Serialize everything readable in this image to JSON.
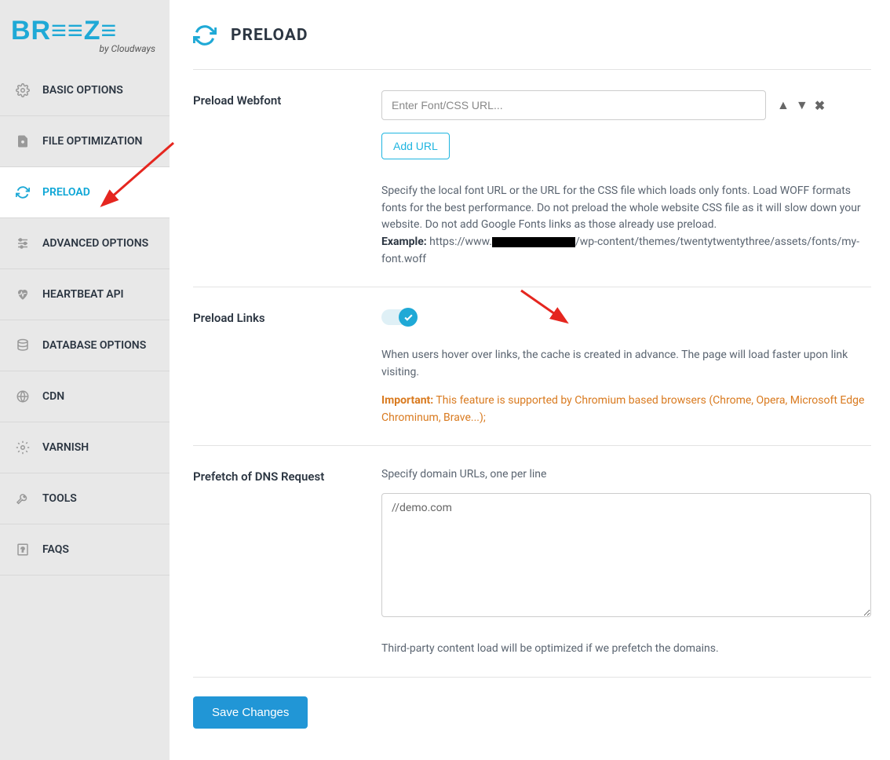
{
  "logo": {
    "brand": "BR≡≡Z≡",
    "by": "by Cloudways"
  },
  "sidebar": {
    "items": [
      {
        "label": "BASIC OPTIONS",
        "icon": "gear-icon"
      },
      {
        "label": "FILE OPTIMIZATION",
        "icon": "file-gear-icon"
      },
      {
        "label": "PRELOAD",
        "icon": "refresh-icon",
        "active": true
      },
      {
        "label": "ADVANCED OPTIONS",
        "icon": "sliders-icon"
      },
      {
        "label": "HEARTBEAT API",
        "icon": "heartbeat-icon"
      },
      {
        "label": "DATABASE OPTIONS",
        "icon": "database-icon"
      },
      {
        "label": "CDN",
        "icon": "globe-icon"
      },
      {
        "label": "VARNISH",
        "icon": "gear-icon"
      },
      {
        "label": "TOOLS",
        "icon": "wrench-icon"
      },
      {
        "label": "FAQS",
        "icon": "help-page-icon"
      }
    ]
  },
  "page": {
    "title": "PRELOAD"
  },
  "preload_webfont": {
    "label": "Preload Webfont",
    "placeholder": "Enter Font/CSS URL...",
    "add_button": "Add URL",
    "help": "Specify the local font URL or the URL for the CSS file which loads only fonts. Load WOFF formats fonts for the best performance. Do not preload the whole website CSS file as it will slow down your website. Do not add Google Fonts links as those already use preload.",
    "example_label": "Example:",
    "example_prefix": " https://www.",
    "example_suffix": "/wp-content/themes/twentytwentythree/assets/fonts/my-font.woff"
  },
  "preload_links": {
    "label": "Preload Links",
    "enabled": true,
    "help": "When users hover over links, the cache is created in advance. The page will load faster upon link visiting.",
    "important_prefix": "Important:",
    "important_text": " This feature is supported by Chromium based browsers (Chrome, Opera, Microsoft Edge Chrominum, Brave...);"
  },
  "prefetch_dns": {
    "label": "Prefetch of DNS Request",
    "sub": "Specify domain URLs, one per line",
    "value": "//demo.com",
    "help": "Third-party content load will be optimized if we prefetch the domains."
  },
  "save_button": "Save Changes",
  "colors": {
    "accent": "#1fa9d6",
    "warn": "#d97a1f"
  }
}
